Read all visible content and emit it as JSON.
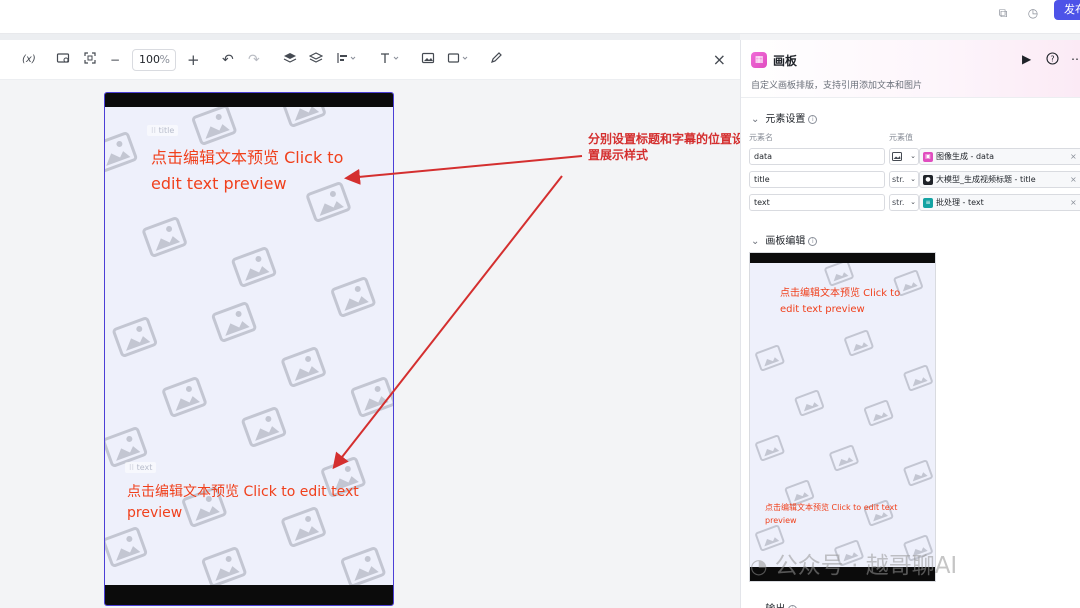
{
  "topbar": {
    "copy_icon": "copy-icon",
    "history_icon": "history-icon",
    "publish_label": "发布"
  },
  "toolbar": {
    "variable_label": "(x)",
    "zoom_value": "100",
    "zoom_unit": "%",
    "icons": [
      "variable-icon",
      "frame-icon",
      "fit-icon",
      "zoom-out-icon",
      "zoom-in-icon",
      "undo-icon",
      "redo-icon",
      "layer-up-icon",
      "layer-down-icon",
      "align-icon",
      "text-icon",
      "image-icon",
      "shape-icon",
      "pen-icon",
      "close-icon"
    ]
  },
  "canvas": {
    "title_tag": "title",
    "text_tag": "text",
    "title_text": "点击编辑文本预览 Click to edit text preview",
    "body_text": "点击编辑文本预览 Click to edit text preview"
  },
  "annotation": {
    "text": "分别设置标题和字幕的位置设置展示样式",
    "color": "#d42f2f"
  },
  "panel": {
    "title": "画板",
    "description": "自定义画板排版，支持引用添加文本和图片",
    "elements_section": "元素设置",
    "col_name": "元素名",
    "col_value": "元素值",
    "rows": [
      {
        "name": "data",
        "type": "",
        "type_icon": "image-icon",
        "source": "图像生成 - data",
        "source_color": "#e04dbf"
      },
      {
        "name": "title",
        "type": "str.",
        "type_icon": "",
        "source": "大模型_生成视频标题 - title",
        "source_color": "#1f2329"
      },
      {
        "name": "text",
        "type": "str.",
        "type_icon": "",
        "source": "批处理 - text",
        "source_color": "#14a3a3"
      }
    ],
    "canvas_section": "画板编辑",
    "preview_title": "点击编辑文本预览 Click to edit text preview",
    "preview_text": "点击编辑文本预览 Click to edit text preview",
    "output_section": "输出"
  },
  "watermark": {
    "text": "公众号 · 越哥聊AI"
  }
}
